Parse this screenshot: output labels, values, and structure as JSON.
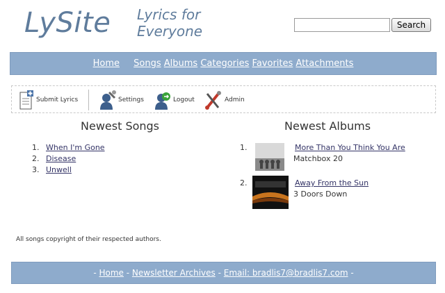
{
  "header": {
    "logo": "LySite",
    "tagline": "Lyrics for Everyone",
    "search_value": "",
    "search_button": "Search"
  },
  "nav": {
    "items": [
      "Home",
      "Songs",
      "Albums",
      "Categories",
      "Favorites",
      "Attachments"
    ]
  },
  "toolbar": {
    "items": [
      {
        "label": "Submit Lyrics",
        "icon": "submit-lyrics-icon"
      },
      {
        "label": "Settings",
        "icon": "settings-icon"
      },
      {
        "label": "Logout",
        "icon": "logout-icon"
      },
      {
        "label": "Admin",
        "icon": "admin-icon"
      }
    ]
  },
  "newest_songs": {
    "title": "Newest Songs",
    "items": [
      {
        "num": "1.",
        "title": "When I'm Gone"
      },
      {
        "num": "2.",
        "title": "Disease"
      },
      {
        "num": "3.",
        "title": "Unwell"
      }
    ]
  },
  "newest_albums": {
    "title": "Newest Albums",
    "items": [
      {
        "num": "1.",
        "title": "More Than You Think You Are",
        "artist": "Matchbox 20"
      },
      {
        "num": "2.",
        "title": "Away From the Sun",
        "artist": "3 Doors Down"
      }
    ]
  },
  "copyright": "All songs copyright of their respected authors.",
  "footer": {
    "sep": "-",
    "home": "Home",
    "newsletter": "Newsletter Archives",
    "email": "Email: bradlis7@bradlis7.com"
  },
  "colors": {
    "bar": "#8eabcc",
    "logo": "#5f7c9c"
  }
}
